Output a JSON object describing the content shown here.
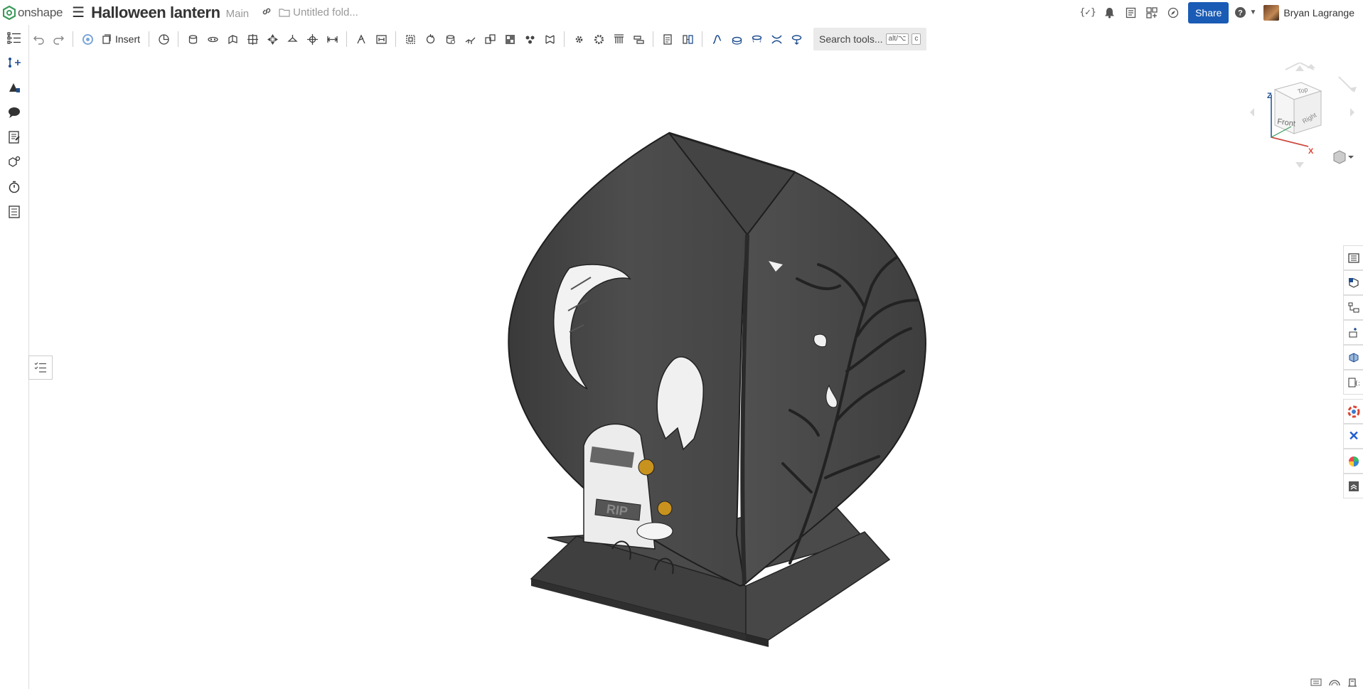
{
  "app": {
    "logo_text": "onshape"
  },
  "document": {
    "title": "Halloween lantern",
    "branch": "Main",
    "folder": "Untitled fold..."
  },
  "topbar": {
    "share_label": "Share",
    "user_name": "Bryan Lagrange",
    "icons": [
      "variables-icon",
      "bell-icon",
      "notes-icon",
      "app-store-icon",
      "learning-icon",
      "help-icon"
    ]
  },
  "toolbar": {
    "insert_label": "Insert",
    "search_label": "Search tools...",
    "search_kbd1": "alt/⌥",
    "search_kbd2": "c"
  },
  "viewcube": {
    "labels": {
      "top": "Top",
      "front": "Front",
      "right": "Right",
      "z": "Z",
      "x": "X"
    }
  },
  "viewport": {
    "engraving": "RIP",
    "model_color": "#4a4a4a"
  },
  "colors": {
    "accent": "#1a5bb5",
    "logo": "#3a9a5b"
  }
}
